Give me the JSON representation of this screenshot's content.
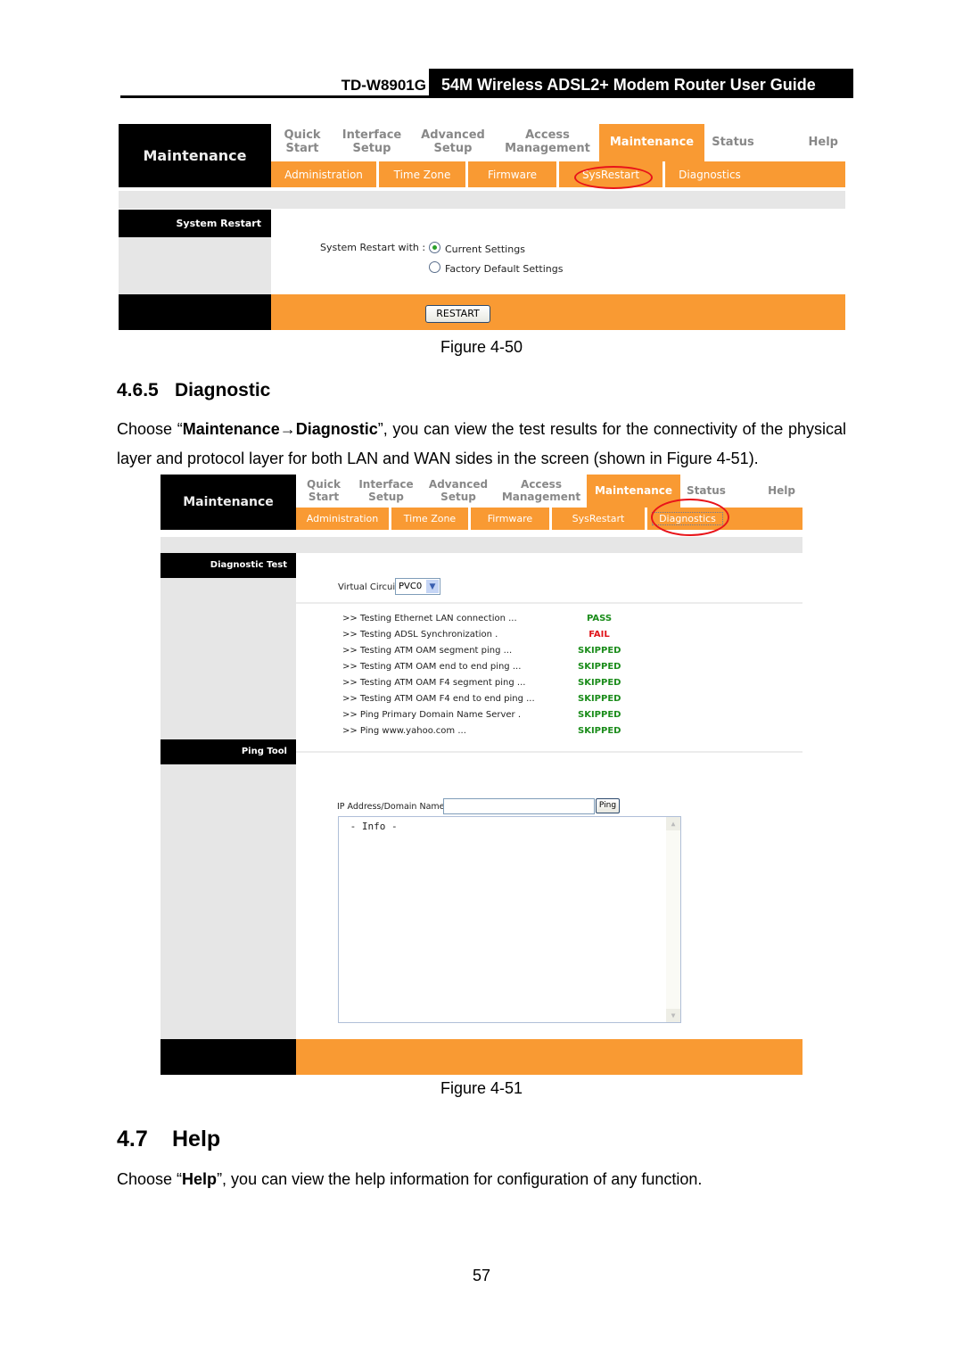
{
  "page_header": {
    "model": "TD-W8901G",
    "title": "54M Wireless ADSL2+ Modem Router User Guide"
  },
  "router_ui": {
    "logo_text": "Maintenance",
    "top_nav": [
      {
        "line1": "Quick",
        "line2": "Start"
      },
      {
        "line1": "Interface",
        "line2": "Setup"
      },
      {
        "line1": "Advanced",
        "line2": "Setup"
      },
      {
        "line1": "Access",
        "line2": "Management"
      },
      {
        "line1": "Maintenance",
        "line2": "",
        "active": true
      },
      {
        "line1": "Status",
        "line2": ""
      },
      {
        "line1": "Help",
        "line2": ""
      }
    ],
    "sub_nav": [
      "Administration",
      "Time Zone",
      "Firmware",
      "SysRestart",
      "Diagnostics"
    ],
    "colors": {
      "accent": "#f99a33",
      "highlight_circle": "#e8141a",
      "pass": "#1a8c1a",
      "fail": "#e0141a"
    }
  },
  "figure_50": {
    "highlighted_subnav": "SysRestart",
    "section_title": "System Restart",
    "restart_with_label": "System Restart with :",
    "options": [
      {
        "label": "Current Settings",
        "selected": true
      },
      {
        "label": "Factory Default Settings",
        "selected": false
      }
    ],
    "restart_button": "RESTART",
    "caption": "Figure 4-50"
  },
  "section_465": {
    "number": "4.6.5",
    "title": "Diagnostic",
    "para_prefix": "Choose “",
    "para_bold": "Maintenance→Diagnostic",
    "para_suffix": "”, you can view the test results for the connectivity of the physical layer and protocol layer for both LAN and WAN sides in the screen (shown in Figure 4-51)."
  },
  "figure_51": {
    "highlighted_subnav": "Diagnostics",
    "diag_section_title": "Diagnostic Test",
    "virtual_circuit_label": "Virtual Circuit:",
    "virtual_circuit_value": "PVC0",
    "tests": [
      {
        "label": ">> Testing Ethernet LAN connection ...",
        "result": "PASS",
        "status": "pass"
      },
      {
        "label": ">> Testing ADSL Synchronization .",
        "result": "FAIL",
        "status": "fail"
      },
      {
        "label": ">> Testing ATM OAM segment ping ...",
        "result": "SKIPPED",
        "status": "pass"
      },
      {
        "label": ">> Testing ATM OAM end to end ping ...",
        "result": "SKIPPED",
        "status": "pass"
      },
      {
        "label": ">> Testing ATM OAM F4 segment ping ...",
        "result": "SKIPPED",
        "status": "pass"
      },
      {
        "label": ">> Testing ATM OAM F4 end to end ping ...",
        "result": "SKIPPED",
        "status": "pass"
      },
      {
        "label": ">> Ping Primary Domain Name Server .",
        "result": "SKIPPED",
        "status": "pass"
      },
      {
        "label": ">> Ping www.yahoo.com ...",
        "result": "SKIPPED",
        "status": "pass"
      }
    ],
    "ping_section_title": "Ping Tool",
    "ip_label": "IP Address/Domain Name:",
    "ip_value": "",
    "ping_button": "Ping",
    "info_text": " - Info -",
    "caption": "Figure 4-51"
  },
  "section_47": {
    "number": "4.7",
    "title": "Help",
    "para_prefix": "Choose “",
    "para_bold": "Help",
    "para_suffix": "”, you can view the help information for configuration of any function."
  },
  "page_number": "57"
}
